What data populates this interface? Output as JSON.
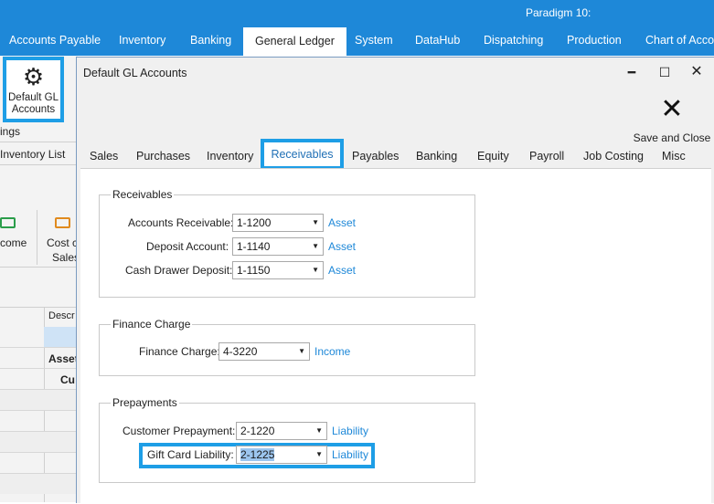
{
  "app": {
    "title": "Paradigm 10:"
  },
  "menu": {
    "tabs": [
      "Accounts Payable",
      "Inventory",
      "Banking",
      "General Ledger",
      "System",
      "DataHub",
      "Dispatching",
      "Production",
      "Chart of Accou"
    ]
  },
  "background": {
    "gear_button": {
      "label_line1": "Default GL",
      "label_line2": "Accounts"
    },
    "settings_cut": "ings",
    "inventory_list": "Inventory List",
    "income_cut": "come",
    "cost_line1": "Cost c",
    "cost_line2": "Sales",
    "desc_header": "Descr",
    "asset_cut": "Asset",
    "cu_cut": "Cu"
  },
  "dialog": {
    "title": "Default GL Accounts",
    "save_close": "Save and Close",
    "tabs": [
      "Sales",
      "Purchases",
      "Inventory",
      "Receivables",
      "Payables",
      "Banking",
      "Equity",
      "Payroll",
      "Job Costing",
      "Misc"
    ],
    "active_tab": "Receivables",
    "groups": {
      "receivables": {
        "title": "Receivables",
        "rows": [
          {
            "label": "Accounts Receivable:",
            "value": "1-1200",
            "type": "Asset"
          },
          {
            "label": "Deposit Account:",
            "value": "1-1140",
            "type": "Asset"
          },
          {
            "label": "Cash Drawer Deposit:",
            "value": "1-1150",
            "type": "Asset"
          }
        ]
      },
      "finance_charge": {
        "title": "Finance Charge",
        "rows": [
          {
            "label": "Finance Charge:",
            "value": "4-3220",
            "type": "Income"
          }
        ]
      },
      "prepayments": {
        "title": "Prepayments",
        "rows": [
          {
            "label": "Customer Prepayment:",
            "value": "2-1220",
            "type": "Liability"
          },
          {
            "label": "Gift Card Liability:",
            "value": "2-1225",
            "type": "Liability"
          }
        ]
      }
    }
  },
  "colors": {
    "accent": "#1e88d8",
    "highlight": "#1e9ee6",
    "selection": "#9cc5ee"
  }
}
